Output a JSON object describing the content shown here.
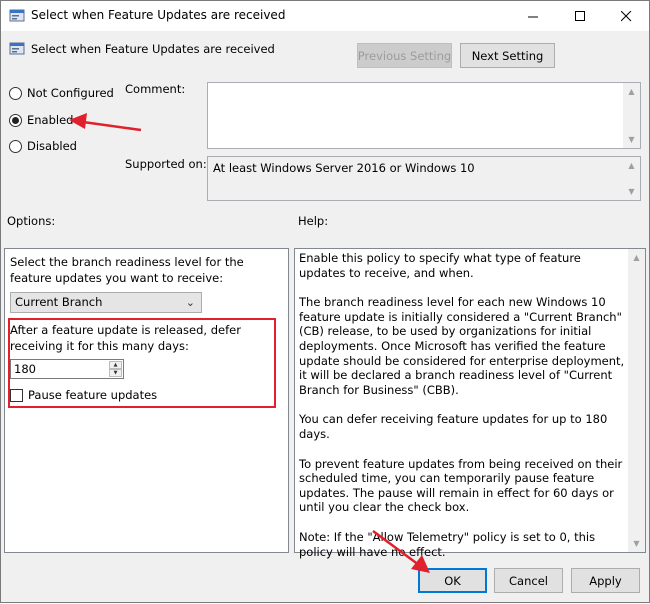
{
  "window": {
    "title": "Select when Feature Updates are received",
    "controls": {
      "minimize": "minimize",
      "maximize": "maximize",
      "close": "close"
    }
  },
  "header": {
    "setting_name": "Select when Feature Updates are received",
    "previous_button": "Previous Setting",
    "next_button": "Next Setting"
  },
  "state": {
    "options": [
      {
        "label": "Not Configured",
        "checked": false
      },
      {
        "label": "Enabled",
        "checked": true
      },
      {
        "label": "Disabled",
        "checked": false
      }
    ]
  },
  "comment": {
    "label": "Comment:",
    "value": ""
  },
  "supported": {
    "label": "Supported on:",
    "value": "At least Windows Server 2016 or Windows 10"
  },
  "options_section": {
    "heading": "Options:",
    "branch_prompt": "Select the branch readiness level for the feature updates you want to receive:",
    "branch_selected": "Current Branch",
    "defer_prompt": "After a feature update is released, defer receiving it for this many days:",
    "defer_days": "180",
    "pause_label": "Pause feature updates",
    "pause_checked": false
  },
  "help_section": {
    "heading": "Help:",
    "paragraphs": [
      "Enable this policy to specify what type of feature updates to receive, and when.",
      "The branch readiness level for each new Windows 10 feature update is initially considered a \"Current Branch\" (CB) release, to be used by organizations for initial deployments. Once Microsoft has verified the feature update should be considered for enterprise deployment, it will be declared a branch readiness level of \"Current Branch for Business\" (CBB).",
      "You can defer receiving feature updates for up to 180 days.",
      "To prevent feature updates from being received on their scheduled time, you can temporarily pause feature updates. The pause will remain in effect for 60 days or until you clear the check box.",
      "Note: If the \"Allow Telemetry\" policy is set to 0, this policy will have no effect."
    ]
  },
  "footer": {
    "ok": "OK",
    "cancel": "Cancel",
    "apply": "Apply"
  },
  "colors": {
    "annotation_red": "#e0202c",
    "focus_blue": "#0078d7"
  }
}
